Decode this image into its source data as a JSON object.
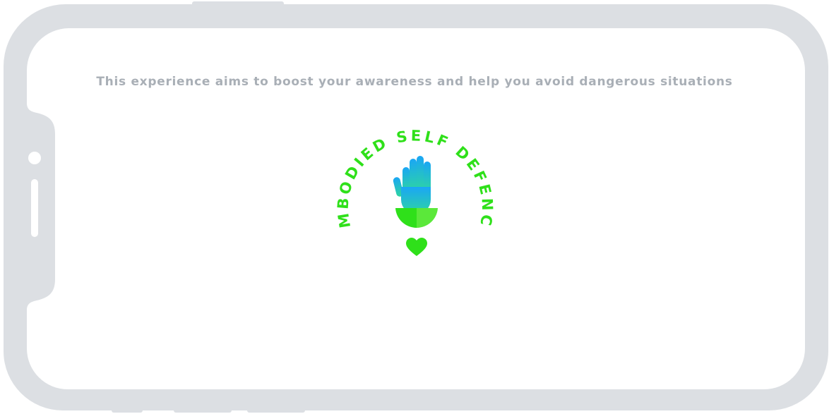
{
  "screen": {
    "tagline": "This experience aims to boost your awareness and help you avoid dangerous situations"
  },
  "logo": {
    "text": "EMBODIED SELF DEFENCE",
    "icon_hand": "hand-icon",
    "icon_leaves": "leaves-icon",
    "icon_heart": "heart-icon"
  },
  "colors": {
    "frame": "#dcdfe3",
    "screen_bg": "#ffffff",
    "tagline": "#a9afb6",
    "brand_green": "#2fe01a",
    "hand_top": "#1aa6f5",
    "hand_bottom": "#2ed6a0"
  }
}
